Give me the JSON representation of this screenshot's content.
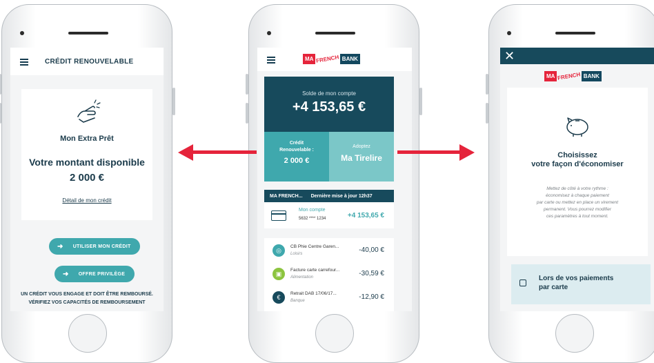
{
  "screen1": {
    "header_title": "CRÉDIT RENOUVELABLE",
    "product_name": "Mon Extra Prêt",
    "available_label": "Votre montant disponible",
    "available_amount": "2 000 €",
    "detail_link": "Détail de mon crédit",
    "use_credit_button": "UTILISER MON CRÉDIT",
    "privilege_offer_button": "OFFRE PRIVILÈGE",
    "legal_line1": "UN CRÉDIT VOUS ENGAGE ET DOIT ÊTRE REMBOURSÉ.",
    "legal_line2": "VÉRIFIEZ VOS CAPACITÉS DE REMBOURSEMENT"
  },
  "screen2": {
    "logo": {
      "ma": "MA",
      "french": "FRENCH",
      "bank": "BANK"
    },
    "balance_label": "Solde de mon compte",
    "balance_value": "+4 153,65 €",
    "credit_label_1": "Crédit",
    "credit_label_2": "Renouvelable :",
    "credit_value": "2 000 €",
    "tirelire_label": "Adoptez",
    "tirelire_value": "Ma Tirelire",
    "account_bar_name": "MA FRENCH...",
    "account_bar_update": "Dernière mise à jour 12h37",
    "account": {
      "name": "Mon compte",
      "number": "5632 **** 1234",
      "amount": "+4 153,65 €"
    },
    "transactions": [
      {
        "name": "CB Phie Centre Garen...",
        "category": "Loisirs",
        "amount": "-40,00 €",
        "color": "#3fa8ad",
        "icon": "leisure-icon"
      },
      {
        "name": "Facture carte carrefour...",
        "category": "Alimentation",
        "amount": "-30,59 €",
        "color": "#8cc43f",
        "icon": "food-icon"
      },
      {
        "name": "Retrait DAB 17/06/17...",
        "category": "Banque",
        "amount": "-12,90 €",
        "color": "#174a5c",
        "icon": "bank-icon"
      }
    ]
  },
  "screen3": {
    "logo": {
      "ma": "MA",
      "french": "FRENCH",
      "bank": "BANK"
    },
    "title_1": "Choisissez",
    "title_2": "votre façon d'économiser",
    "text_1": "Mettez de côté à votre rythme :",
    "text_2": "économisez à chaque paiement",
    "text_3": "par carte ou mettez en place un virement",
    "text_4": "permanent. Vous pourrez modifier",
    "text_5": "ces paramètres à tout moment.",
    "option_1": "Lors de vos paiements",
    "option_2": "par carte"
  },
  "colors": {
    "accent": "#3fa8ad",
    "navy": "#174a5c",
    "brand_red": "#e5243b"
  }
}
